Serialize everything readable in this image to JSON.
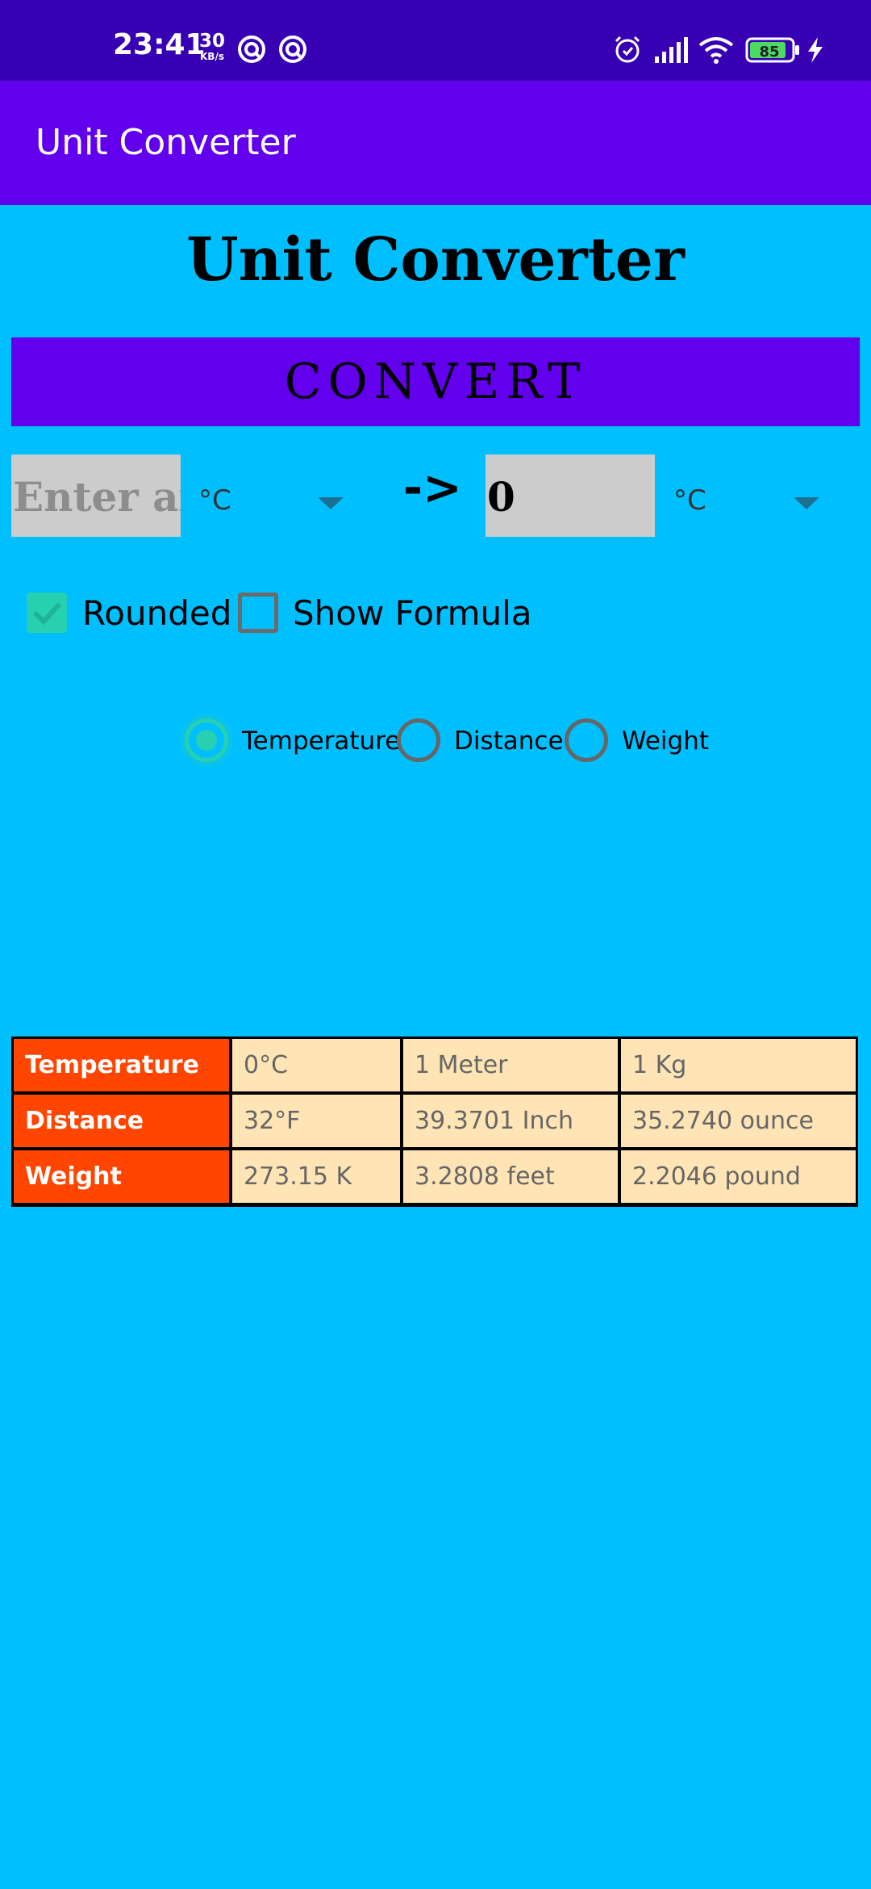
{
  "status_bar": {
    "time": "23:41",
    "net_speed_value": "30",
    "net_speed_unit": "KB/s",
    "battery": "85",
    "icons": [
      "vpn-icon",
      "vpn-icon",
      "alarm-icon",
      "signal-icon",
      "wifi-icon",
      "battery-icon",
      "charging-icon"
    ]
  },
  "app_bar": {
    "title": "Unit Converter"
  },
  "main": {
    "heading": "Unit Converter",
    "convert_label": "CONVERT",
    "from_input": {
      "value": "",
      "placeholder": "Enter any"
    },
    "from_unit": "°C",
    "arrow": "->",
    "to_output": "0",
    "to_unit": "°C",
    "options": [
      {
        "label": "Rounded",
        "checked": true
      },
      {
        "label": "Show Formula",
        "checked": false
      }
    ],
    "unit_types": [
      {
        "label": "Temperature",
        "selected": true
      },
      {
        "label": "Distance",
        "selected": false
      },
      {
        "label": "Weight",
        "selected": false
      }
    ]
  },
  "reference_table": {
    "rows": [
      {
        "header": "Temperature",
        "cells": [
          "0°C",
          "1 Meter",
          "1 Kg"
        ]
      },
      {
        "header": "Distance",
        "cells": [
          "32°F",
          "39.3701 Inch",
          "35.2740 ounce"
        ]
      },
      {
        "header": "Weight",
        "cells": [
          "273.15 K",
          "3.2808 feet",
          "2.2046 pound"
        ]
      }
    ]
  },
  "colors": {
    "status_bar": "#3700b3",
    "primary": "#6200ee",
    "background": "#00bfff",
    "accent": "#26d0b0",
    "table_header": "#ff4500",
    "table_cell": "#ffe4b5"
  }
}
